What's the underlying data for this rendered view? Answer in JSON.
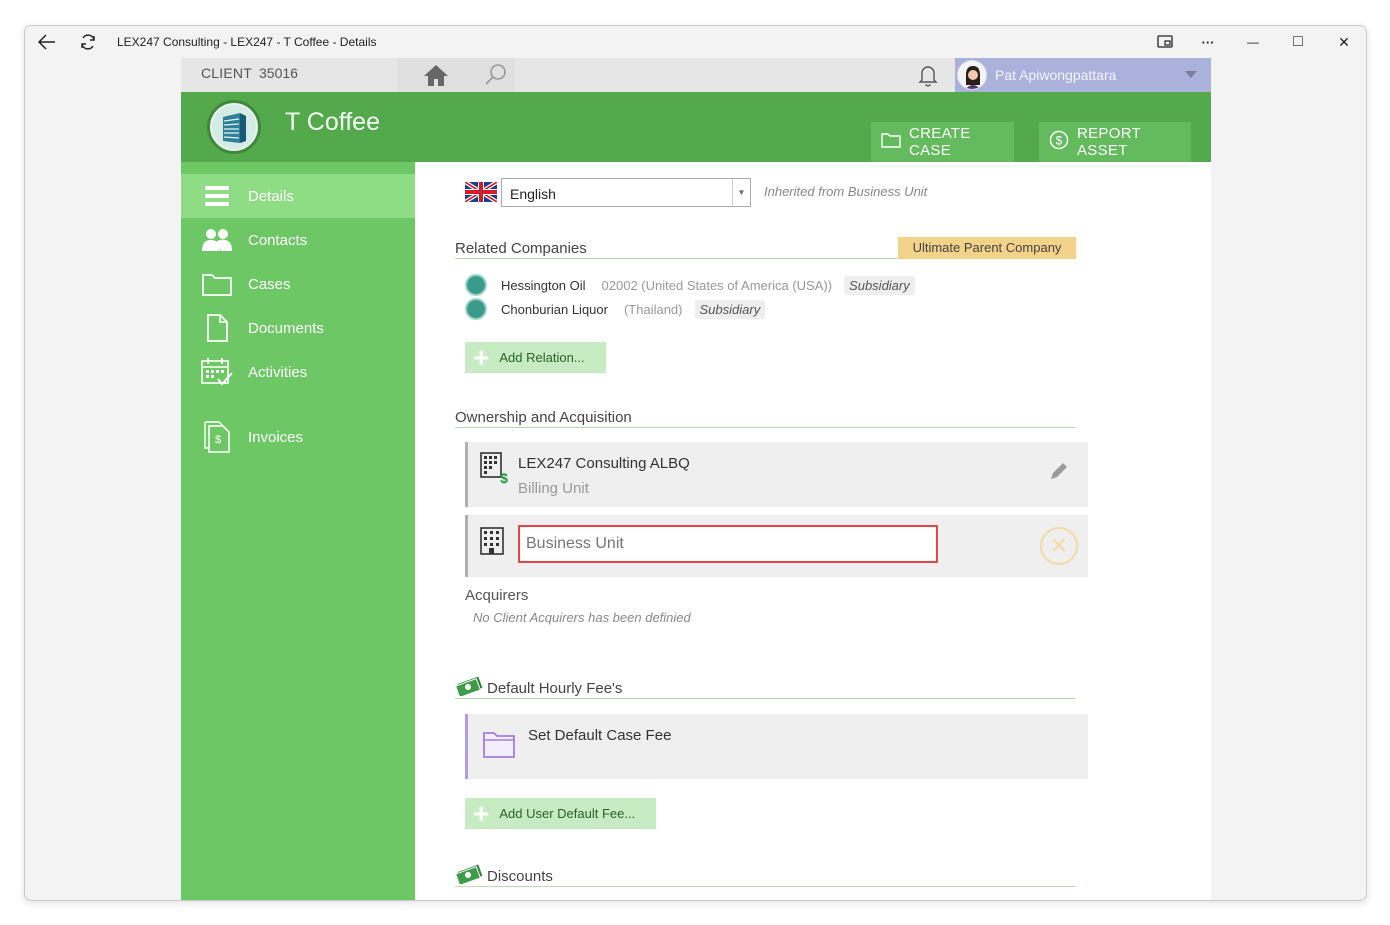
{
  "window": {
    "title": "LEX247 Consulting - LEX247 - T Coffee - Details",
    "controls": {
      "minimize": "—",
      "maximize": "□",
      "close": "✕",
      "more": "···"
    }
  },
  "topbar": {
    "client_label": "CLIENT",
    "client_number": "35016",
    "user_name": "Pat Apiwongpattara"
  },
  "header": {
    "title": "T Coffee",
    "create_case_label": "CREATE CASE",
    "report_asset_label": "REPORT ASSET"
  },
  "sidebar": {
    "items": [
      {
        "label": "Details",
        "icon": "list-icon",
        "active": true
      },
      {
        "label": "Contacts",
        "icon": "contacts-icon",
        "active": false
      },
      {
        "label": "Cases",
        "icon": "folder-icon",
        "active": false
      },
      {
        "label": "Documents",
        "icon": "document-icon",
        "active": false
      },
      {
        "label": "Activities",
        "icon": "calendar-icon",
        "active": false
      },
      {
        "label": "Invoices",
        "icon": "invoice-icon",
        "active": false
      }
    ]
  },
  "details": {
    "language": "English",
    "inherited_note": "Inherited from Business Unit",
    "related_companies_title": "Related Companies",
    "ultimate_parent_label": "Ultimate Parent Company",
    "related": [
      {
        "name": "Hessington Oil",
        "code": "02002 (United States of America (USA))",
        "relation": "Subsidiary"
      },
      {
        "name": "Chonburian Liquor",
        "code": "(Thailand)",
        "relation": "Subsidiary"
      }
    ],
    "add_relation_label": "Add Relation...",
    "ownership_title": "Ownership and Acquisition",
    "billing_unit_name": "LEX247 Consulting ALBQ",
    "billing_unit_sub": "Billing Unit",
    "business_unit_placeholder": "Business Unit",
    "acquirers_title": "Acquirers",
    "acquirers_empty": "No Client Acquirers has been definied",
    "hourly_fee_title": "Default Hourly Fee's",
    "set_default_fee_label": "Set Default Case Fee",
    "add_user_fee_label": "Add User Default Fee...",
    "discounts_title": "Discounts"
  },
  "colors": {
    "header_green": "#53a94c",
    "sidebar_green": "#6ec765",
    "active_nav": "#8edd85",
    "user_area": "#aab1da",
    "badge_gold": "#f3d28a",
    "error_red": "#e0474c"
  }
}
